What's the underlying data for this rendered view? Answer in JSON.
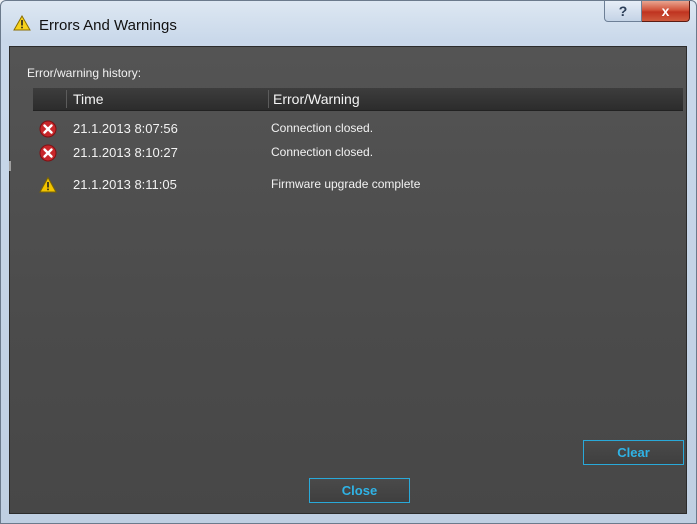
{
  "window": {
    "title": "Errors And Warnings",
    "help_glyph": "?",
    "close_glyph": "x"
  },
  "main": {
    "history_label": "Error/warning history:",
    "columns": {
      "time": "Time",
      "message": "Error/Warning"
    },
    "rows": [
      {
        "type": "error",
        "time": "21.1.2013 8:07:56",
        "message": "Connection closed."
      },
      {
        "type": "error",
        "time": "21.1.2013 8:10:27",
        "message": "Connection closed."
      },
      {
        "type": "warning",
        "time": "21.1.2013 8:11:05",
        "message": "Firmware upgrade complete"
      }
    ]
  },
  "buttons": {
    "clear": "Clear",
    "close": "Close"
  },
  "colors": {
    "accent": "#2fb3e6",
    "panel": "#4e4e4e",
    "error": "#c8272a",
    "warning": "#f2c400"
  },
  "icons": {
    "title": "warning-icon",
    "error_row": "error-icon",
    "warning_row": "warning-icon"
  }
}
